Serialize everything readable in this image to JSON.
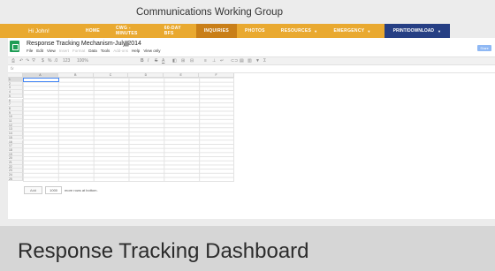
{
  "site": {
    "title": "Communications Working Group"
  },
  "nav": {
    "greeting": "Hi John!",
    "items": [
      {
        "label": "HOME",
        "active": false,
        "dropdown": false
      },
      {
        "label": "CWG - MINUTES",
        "active": false,
        "dropdown": false
      },
      {
        "label": "60-DAY BFS",
        "active": false,
        "dropdown": false
      },
      {
        "label": "INQUIRIES",
        "active": true,
        "dropdown": false
      },
      {
        "label": "PHOTOS",
        "active": false,
        "dropdown": false
      },
      {
        "label": "RESOURCES",
        "active": false,
        "dropdown": true
      },
      {
        "label": "EMERGENCY",
        "active": false,
        "dropdown": true
      }
    ],
    "print": "PRINT/DOWNLOAD",
    "colors": {
      "bar": "#e9a930",
      "active": "#c97f18",
      "print": "#263f84"
    }
  },
  "sheet": {
    "doc_title": "Response Tracking Mechanism-July 2014",
    "title_icons": "☆ ▇",
    "menu": [
      {
        "label": "File",
        "dim": false
      },
      {
        "label": "Edit",
        "dim": false
      },
      {
        "label": "View",
        "dim": false
      },
      {
        "label": "Insert",
        "dim": true
      },
      {
        "label": "Format",
        "dim": true
      },
      {
        "label": "Data",
        "dim": false
      },
      {
        "label": "Tools",
        "dim": false
      },
      {
        "label": "Add-ons",
        "dim": true
      },
      {
        "label": "Help",
        "dim": false
      },
      {
        "label": "View only",
        "dim": false
      }
    ],
    "share_label": "Share",
    "fx_label": "fx",
    "zoom": "100%",
    "columns": [
      "A",
      "B",
      "C",
      "D",
      "E",
      "F"
    ],
    "rows": [
      "1",
      "2",
      "3",
      "4",
      "5",
      "6",
      "7",
      "8",
      "9",
      "10",
      "11",
      "12",
      "13",
      "14",
      "15",
      "16",
      "17",
      "18",
      "19",
      "20",
      "21",
      "22",
      "23",
      "24",
      "25"
    ],
    "add_button": "Add",
    "add_count": "1000",
    "add_suffix": "more rows at bottom."
  },
  "footer": {
    "title": "Response Tracking Dashboard"
  }
}
